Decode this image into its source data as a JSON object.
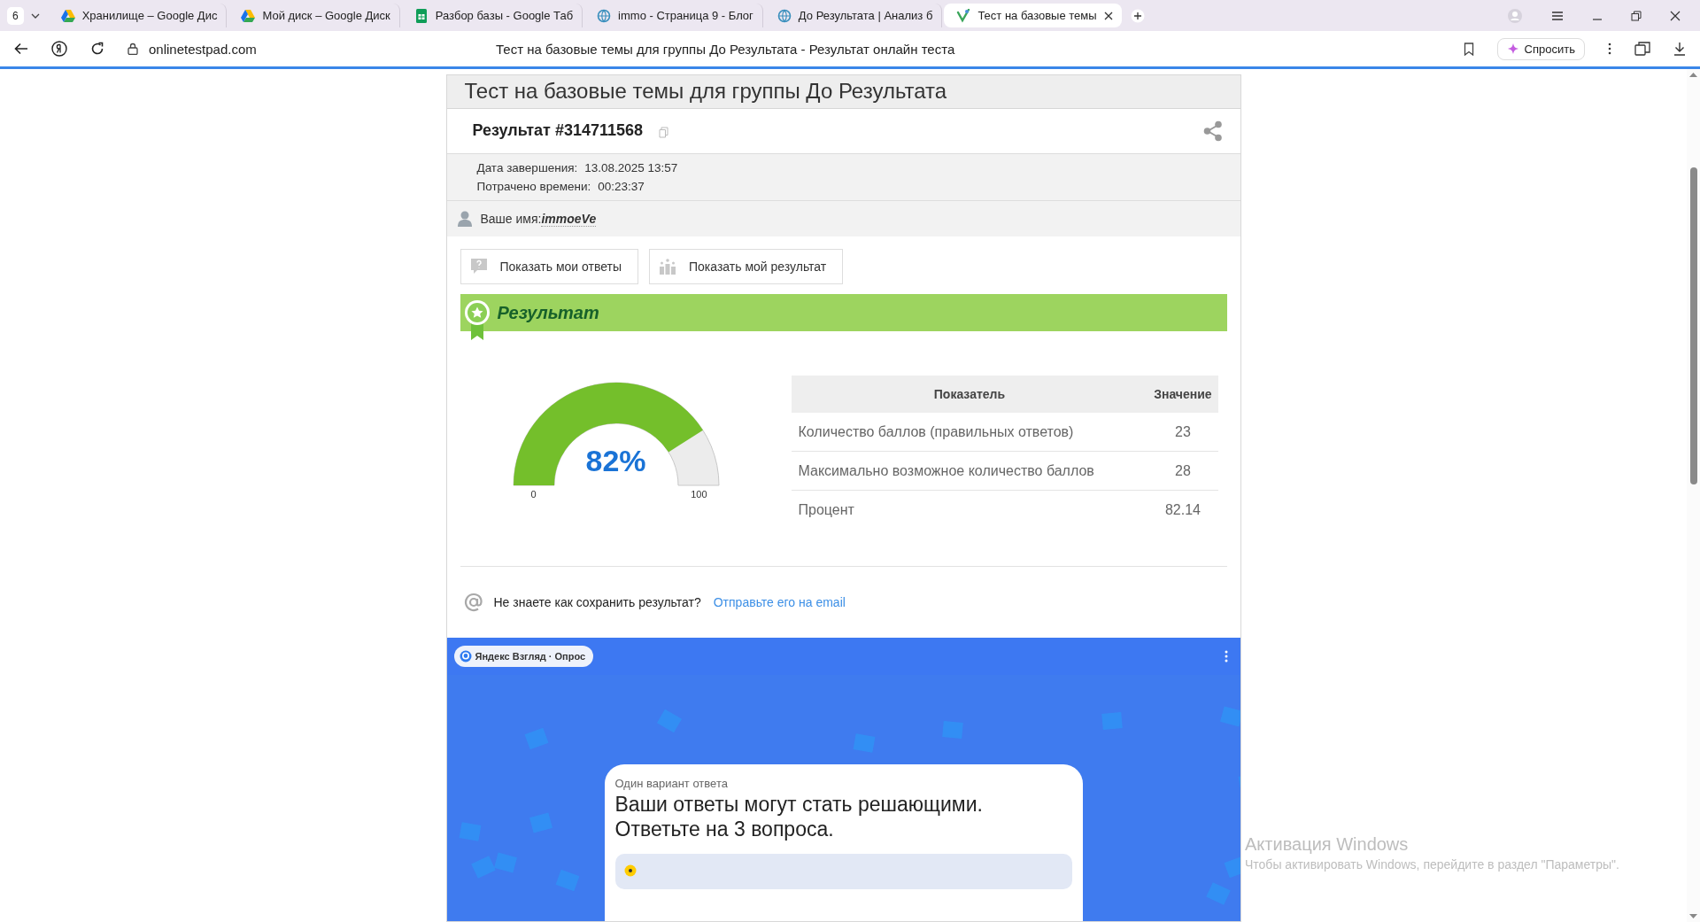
{
  "browser": {
    "tab_count": "6",
    "tabs": [
      {
        "title": "Хранилище – Google Дис",
        "selected": false
      },
      {
        "title": "Мой диск – Google Диск",
        "selected": false
      },
      {
        "title": "Разбор базы - Google Таб",
        "selected": false
      },
      {
        "title": "immo - Страница 9 - Блог",
        "selected": false
      },
      {
        "title": "До Результата | Анализ б",
        "selected": false
      },
      {
        "title": "Тест на базовые темы",
        "selected": true
      }
    ],
    "address": "onlinetestpad.com",
    "page_title": "Тест на базовые темы для группы До Результата - Результат онлайн теста",
    "ask_button": "Спросить"
  },
  "test": {
    "title": "Тест на базовые темы для группы До Результата",
    "result_title": "Результат #314711568",
    "details": [
      {
        "label": "Дата завершения:",
        "value": "13.08.2025 13:57"
      },
      {
        "label": "Потрачено времени:",
        "value": "00:23:37"
      }
    ],
    "name_label": "Ваше имя:",
    "name_value": "immoeVe",
    "buttons": [
      "Показать мои ответы",
      "Показать мой результат"
    ],
    "result_heading": "Результат",
    "gauge": {
      "label": "82%",
      "min_label": "0",
      "max_label": "100"
    },
    "table": {
      "columns": [
        "Показатель",
        "Значение"
      ],
      "rows": [
        [
          "Количество баллов (правильных ответов)",
          "23"
        ],
        [
          "Максимально возможное количество баллов",
          "28"
        ],
        [
          "Процент",
          "82.14"
        ]
      ]
    },
    "save_prompt": "Не знаете как сохранить результат?",
    "save_link": "Отправьте его на email"
  },
  "survey": {
    "badge": "Яндекс Взгляд · Опрос",
    "hint": "Один вариант ответа",
    "question": "Ваши ответы могут стать решающими. Ответьте на 3 вопроса."
  },
  "os_watermark": {
    "title": "Активация Windows",
    "text": "Чтобы активировать Windows, перейдите в раздел \"Параметры\"."
  }
}
